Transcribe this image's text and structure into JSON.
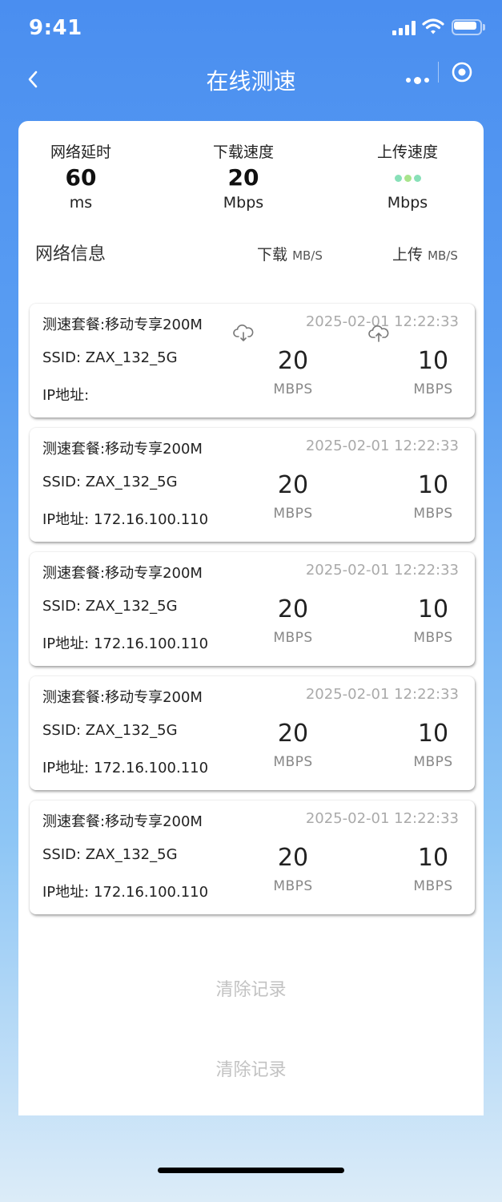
{
  "status_bar": {
    "time": "9:41"
  },
  "nav": {
    "title": "在线测速"
  },
  "metrics": [
    {
      "label": "网络延时",
      "value": "60",
      "unit": "ms"
    },
    {
      "label": "下载速度",
      "value": "20",
      "unit": "Mbps"
    },
    {
      "label": "上传速度",
      "value": "",
      "unit": "Mbps"
    }
  ],
  "section": {
    "title": "网络信息",
    "download_label": "下载",
    "upload_label": "上传",
    "col_unit": "MB/S"
  },
  "records": [
    {
      "plan": "测速套餐:移动专享200M",
      "time": "2025-02-01 12:22:33",
      "ssid": "SSID: ZAX_132_5G",
      "ip": "IP地址:",
      "download": "20",
      "upload": "10",
      "unit": "MBPS"
    },
    {
      "plan": "测速套餐:移动专享200M",
      "time": "2025-02-01 12:22:33",
      "ssid": "SSID: ZAX_132_5G",
      "ip": "IP地址: 172.16.100.110",
      "download": "20",
      "upload": "10",
      "unit": "MBPS"
    },
    {
      "plan": "测速套餐:移动专享200M",
      "time": "2025-02-01 12:22:33",
      "ssid": "SSID: ZAX_132_5G",
      "ip": "IP地址: 172.16.100.110",
      "download": "20",
      "upload": "10",
      "unit": "MBPS"
    },
    {
      "plan": "测速套餐:移动专享200M",
      "time": "2025-02-01 12:22:33",
      "ssid": "SSID: ZAX_132_5G",
      "ip": "IP地址: 172.16.100.110",
      "download": "20",
      "upload": "10",
      "unit": "MBPS"
    },
    {
      "plan": "测速套餐:移动专享200M",
      "time": "2025-02-01 12:22:33",
      "ssid": "SSID: ZAX_132_5G",
      "ip": "IP地址: 172.16.100.110",
      "download": "20",
      "upload": "10",
      "unit": "MBPS"
    }
  ],
  "buttons": {
    "clear_1": "清除记录",
    "clear_2": "清除记录"
  },
  "icons": [
    "signal-icon",
    "wifi-icon",
    "battery-icon",
    "back-icon",
    "more-icon",
    "target-icon",
    "cloud-download-icon",
    "cloud-upload-icon"
  ],
  "colors": {
    "primary_blue": "#4a8ef0",
    "loading_dot": "#88e0b8",
    "muted_text": "#aaaaaa",
    "clear_button": "#c2c2c2"
  }
}
